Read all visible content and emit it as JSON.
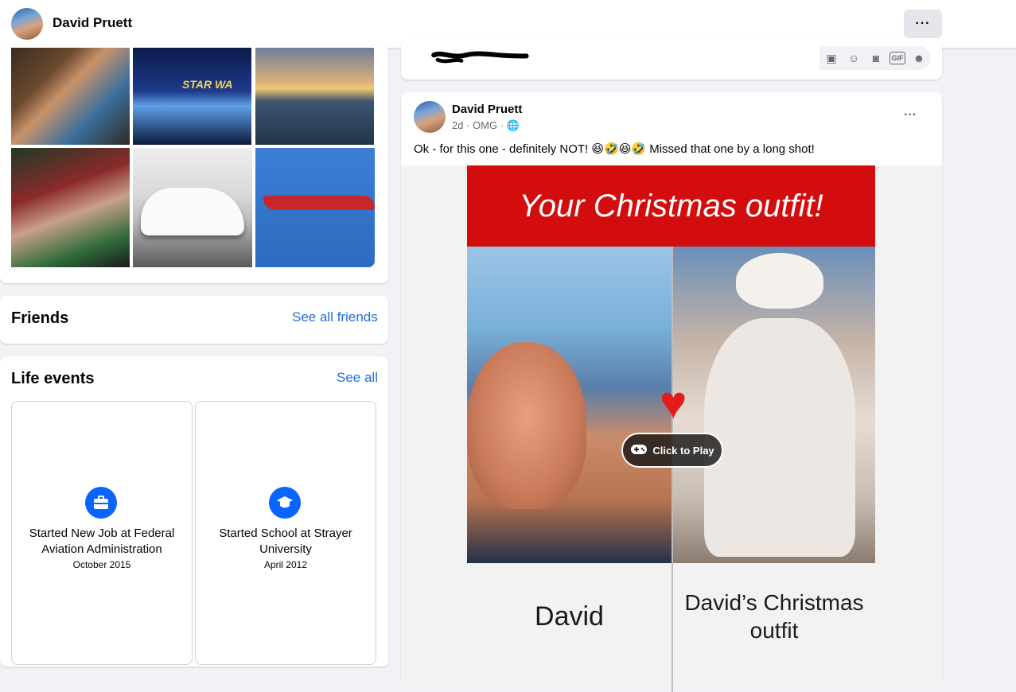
{
  "header": {
    "name": "David Pruett",
    "more_label": "···"
  },
  "photos": {
    "items": [
      {
        "label": "couple photo"
      },
      {
        "label": "Disney Fantasy Star Wars",
        "overlay": "STAR WA"
      },
      {
        "label": "sunset over ocean"
      },
      {
        "label": "children by christmas tree"
      },
      {
        "label": "white sports car"
      },
      {
        "label": "red jet"
      }
    ]
  },
  "friends": {
    "title": "Friends",
    "link": "See all friends"
  },
  "life_events": {
    "title": "Life events",
    "link": "See all",
    "items": [
      {
        "icon": "briefcase-icon",
        "title": "Started New Job at Federal Aviation Administration",
        "date": "October 2015"
      },
      {
        "icon": "graduation-cap-icon",
        "title": "Started School at Strayer University",
        "date": "April 2012"
      }
    ]
  },
  "composer": {
    "icons": [
      "sticker-icon",
      "emoji-icon",
      "camera-icon",
      "gif-icon",
      "avatar-sticker-icon"
    ]
  },
  "post": {
    "author": "David Pruett",
    "meta": "2d · OMG · 🌐",
    "more_label": "···",
    "text": "Ok - for this one - definitely NOT! 😆🤣😆🤣 Missed that one by a long shot!",
    "media": {
      "banner": "Your Christmas outfit!",
      "play_label": "Click to Play",
      "left_label": "David",
      "right_label": "David’s Christmas outfit"
    }
  },
  "colors": {
    "accent": "#0866ff",
    "link": "#216fdb",
    "banner": "#d30d0d"
  }
}
